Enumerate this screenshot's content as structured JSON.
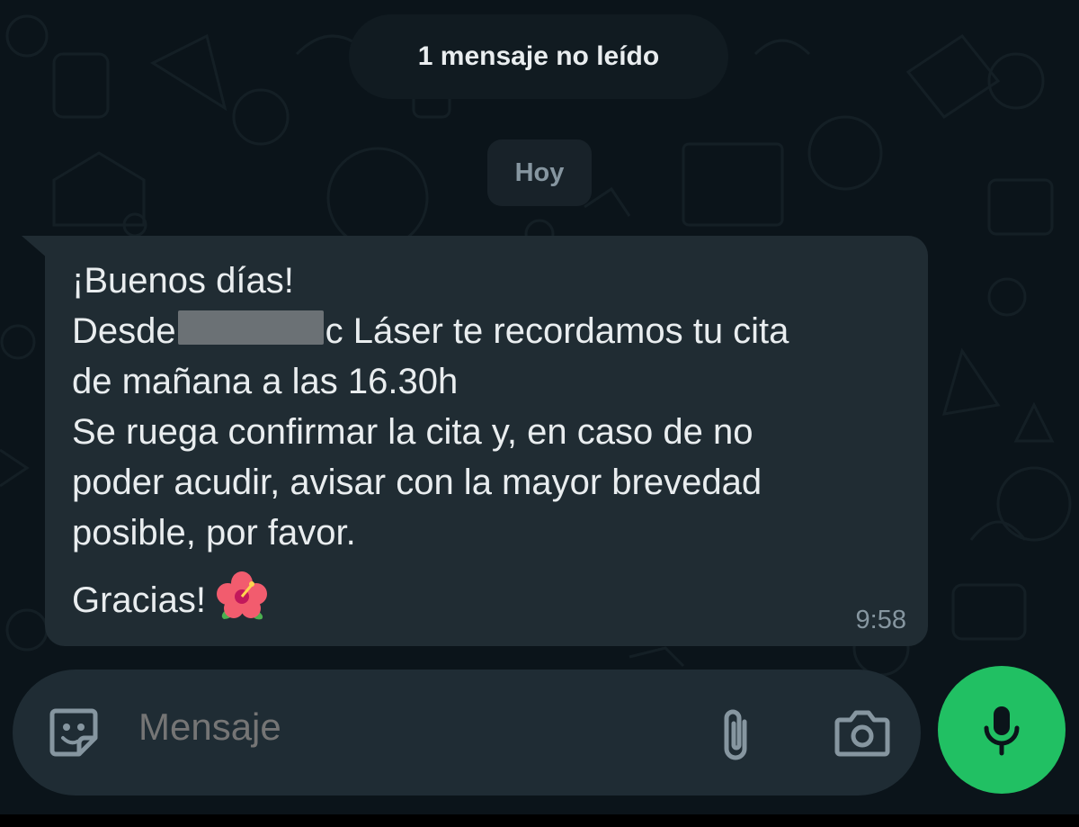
{
  "chat": {
    "unread_banner": "1 mensaje no leído",
    "date_divider": "Hoy"
  },
  "message": {
    "lines": [
      "¡Buenos días!",
      "Láser te recordamos tu cita",
      "de mañana a las 16.30h",
      "Se ruega confirmar la cita y, en caso de no",
      "poder acudir, avisar con la mayor brevedad",
      "posible, por favor.",
      "Gracias!"
    ],
    "line2_prefix": "Desde",
    "line2_partial": "c",
    "emoji": "hibiscus-emoji",
    "time": "9:58"
  },
  "composer": {
    "placeholder": "Mensaje",
    "icons": [
      "sticker-icon",
      "paperclip-icon",
      "camera-icon",
      "mic-icon"
    ]
  },
  "colors": {
    "background": "#0b141a",
    "bubble": "#202c33",
    "input": "#1f2c34",
    "accent": "#21c063",
    "text": "#e9edef",
    "muted": "#8696a0"
  }
}
